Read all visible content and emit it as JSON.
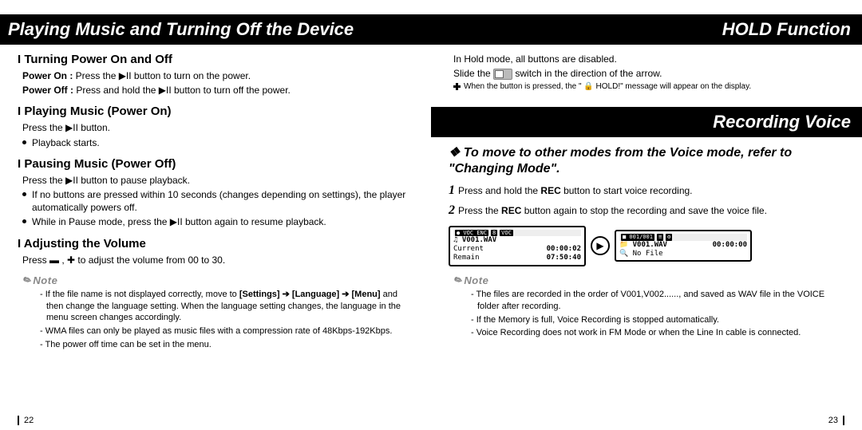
{
  "left": {
    "bar_title": "Playing Music and Turning Off the Device",
    "s1_h": "Turning Power On and Off",
    "s1_l1a": "Power On :",
    "s1_l1b": "  Press the ▶II  button to turn on the power.",
    "s1_l2a": "Power Off :",
    "s1_l2b": "  Press and hold the ▶II button to turn off the power.",
    "s2_h": "Playing Music (Power On)",
    "s2_l1": "Press the ▶II button.",
    "s2_b1": "Playback starts.",
    "s3_h": "Pausing Music (Power Off)",
    "s3_l1": "Press the ▶II button to pause playback.",
    "s3_b1": "If no buttons are pressed within 10 seconds (changes depending on settings), the player automatically powers off.",
    "s3_b2": "While in Pause mode, press the ▶II button again to resume playback.",
    "s4_h": "Adjusting the Volume",
    "s4_l1": "Press ▬ , ✚ to adjust the volume from 00 to 30.",
    "note_label": "Note",
    "note1a": "- If the file name is not displayed correctly, move to ",
    "note1b": "[Settings] ➔ [Language] ➔ [Menu]",
    "note1c": " and then change the language setting. When the language setting changes, the language in the menu screen changes accordingly.",
    "note2": "- WMA files can only be played as music files with a compression rate of 48Kbps-192Kbps.",
    "note3": "- The power off time can be set in the menu.",
    "page_no": "22"
  },
  "right": {
    "bar_title1": "HOLD Function",
    "l1": "In Hold mode, all buttons are disabled.",
    "l2a": "Slide the ",
    "l2b": " switch in the direction of the arrow.",
    "l3": "When the button is pressed, the \" 🔒 HOLD!\" message will appear on the display.",
    "bar_title2": "Recording Voice",
    "aster": "❖ To move to other modes from the Voice mode, refer to \"Changing Mode\".",
    "step1a": "Press and hold the ",
    "step1_rec": "REC",
    "step1b": " button to start voice recording.",
    "step2a": "Press the ",
    "step2_rec": "REC",
    "step2b": " button again to stop the recording and save the voice file.",
    "lcd1_top": "● VOC ENC",
    "lcd1_file": "V001.WAV",
    "lcd1_cur_l": "Current",
    "lcd1_cur_v": "00:00:02",
    "lcd1_rem_l": "Remain",
    "lcd1_rem_v": "07:50:40",
    "lcd2_top": "■ 001/001",
    "lcd2_file": "V001.WAV",
    "lcd2_time": "00:00:00",
    "lcd2_nofile": "No File",
    "note_label": "Note",
    "rn1": "- The files are recorded in the order of V001,V002......, and saved as WAV file in the VOICE folder after recording.",
    "rn2": "- If the Memory is full, Voice Recording is stopped automatically.",
    "rn3": "- Voice Recording does not work in FM Mode or when the Line In cable is connected.",
    "page_no": "23"
  }
}
